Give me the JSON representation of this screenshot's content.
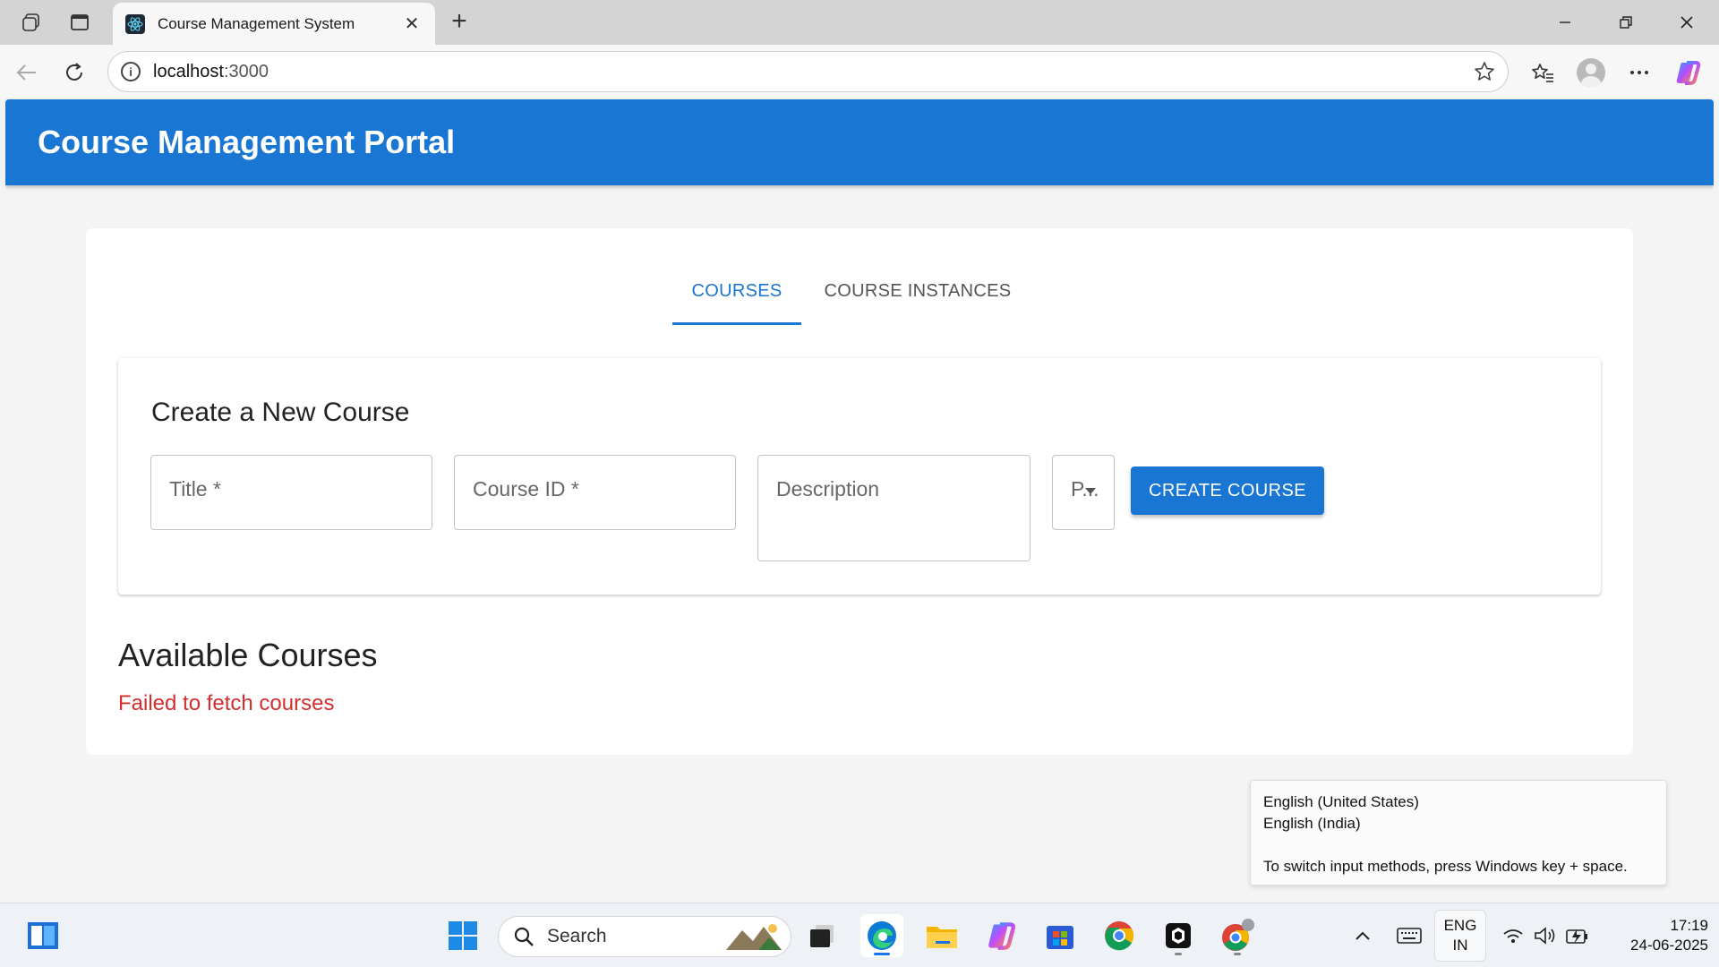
{
  "browser": {
    "tab_title": "Course Management System",
    "url_host": "localhost",
    "url_port": ":3000"
  },
  "app": {
    "title": "Course Management Portal",
    "tabs": [
      {
        "label": "COURSES",
        "active": true
      },
      {
        "label": "COURSE INSTANCES",
        "active": false
      }
    ],
    "form": {
      "heading": "Create a New Course",
      "title_label": "Title *",
      "course_id_label": "Course ID *",
      "description_label": "Description",
      "prereq_label": "P...",
      "submit_label": "CREATE COURSE"
    },
    "list": {
      "heading": "Available Courses",
      "error": "Failed to fetch courses"
    },
    "colors": {
      "primary": "#1976d2",
      "error": "#d32f2f"
    }
  },
  "language_popup": {
    "line1": "English (United States)",
    "line2": "English (India)",
    "hint": "To switch input methods, press Windows key + space."
  },
  "taskbar": {
    "search_label": "Search",
    "lang_top": "ENG",
    "lang_bottom": "IN",
    "time": "17:19",
    "date": "24-06-2025"
  }
}
